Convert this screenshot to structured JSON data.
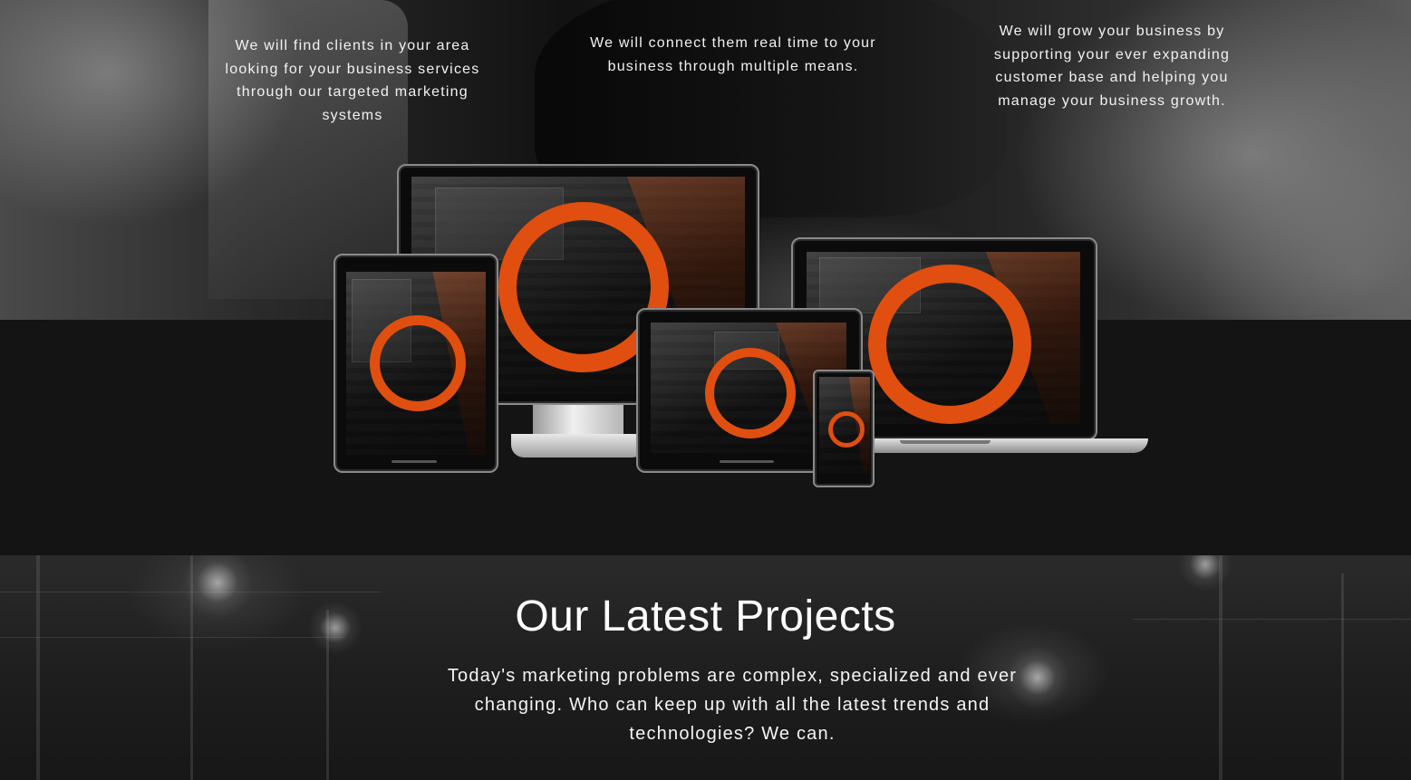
{
  "features": [
    {
      "text": "We will find clients in your area looking for your business services through our targeted marketing systems"
    },
    {
      "text": "We will connect them real time to your business through multiple means."
    },
    {
      "text": "We will grow your business by supporting your ever expanding customer base and helping you manage your business growth."
    }
  ],
  "devices": {
    "accent_color": "#e04f0f"
  },
  "projects": {
    "title": "Our Latest Projects",
    "description": "Today's marketing problems are complex, specialized and ever changing. Who can keep up with all the latest trends and technologies? We can."
  }
}
